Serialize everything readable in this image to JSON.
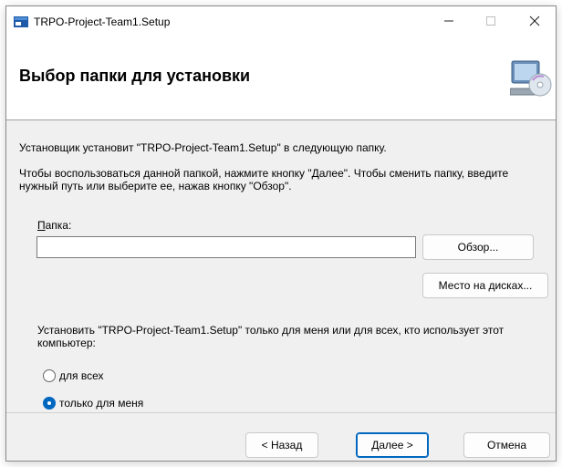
{
  "window": {
    "title": "TRPO-Project-Team1.Setup",
    "minimize_icon": "minimize-icon",
    "maximize_icon": "maximize-icon",
    "close_icon": "close-icon"
  },
  "header": {
    "title": "Выбор папки для установки",
    "graphic_icon": "computer-cd-icon"
  },
  "content": {
    "intro": "Установщик установит \"TRPO-Project-Team1.Setup\" в следующую папку.",
    "instructions": "Чтобы воспользоваться данной папкой, нажмите кнопку \"Далее\". Чтобы сменить папку, введите нужный путь или выберите ее, нажав кнопку \"Обзор\".",
    "folder_label_accel": "П",
    "folder_label_rest": "апка:",
    "folder_value": "",
    "browse_label": "Обзор...",
    "disk_label": "Место на дисках...",
    "install_question": "Установить \"TRPO-Project-Team1.Setup\" только для меня или для всех, кто использует этот компьютер:",
    "radio_all": "для всех",
    "radio_me": "только для меня",
    "selected_option": "только для меня"
  },
  "footer": {
    "back_label": "< Назад",
    "next_label": "Далее >",
    "cancel_label": "Отмена"
  },
  "colors": {
    "accent": "#0067c0",
    "window_bg": "#f0f0f0",
    "header_bg": "#ffffff"
  }
}
